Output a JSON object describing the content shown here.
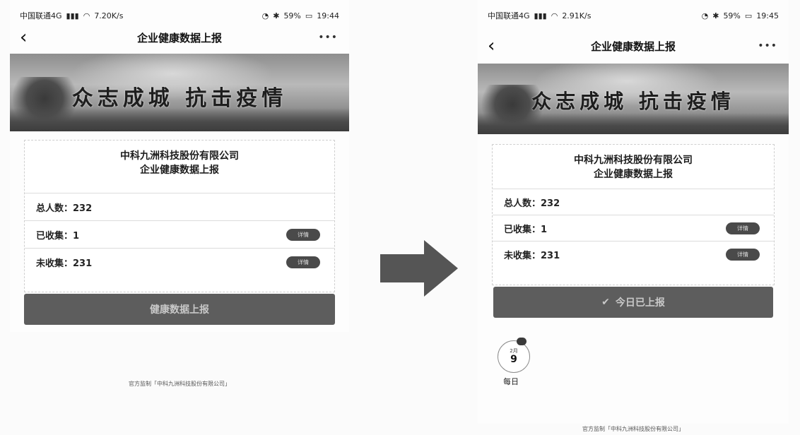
{
  "left": {
    "status": {
      "carrier": "中国联通4G",
      "speed": "7.20K/s",
      "battery": "59%",
      "time": "19:44"
    },
    "nav": {
      "back": "‹",
      "title": "企业健康数据上报",
      "more": "•••"
    },
    "banner": {
      "slogan": "众志成城 抗击疫情"
    },
    "card": {
      "company": "中科九洲科技股份有限公司",
      "subtitle": "企业健康数据上报",
      "rows": [
        {
          "label": "总人数：232",
          "pill": ""
        },
        {
          "label": "已收集：1",
          "pill": "详情"
        },
        {
          "label": "未收集：231",
          "pill": "详情"
        }
      ]
    },
    "button": {
      "label": "健康数据上报"
    },
    "footer": "官方监制「中科九洲科技股份有限公司」"
  },
  "right": {
    "status": {
      "carrier": "中国联通4G",
      "speed": "2.91K/s",
      "battery": "59%",
      "time": "19:45"
    },
    "nav": {
      "back": "‹",
      "title": "企业健康数据上报",
      "more": "•••"
    },
    "banner": {
      "slogan": "众志成城 抗击疫情"
    },
    "card": {
      "company": "中科九洲科技股份有限公司",
      "subtitle": "企业健康数据上报",
      "rows": [
        {
          "label": "总人数：232",
          "pill": ""
        },
        {
          "label": "已收集：1",
          "pill": "详情"
        },
        {
          "label": "未收集：231",
          "pill": "详情"
        }
      ]
    },
    "button": {
      "icon": "✔",
      "label": "今日已上报"
    },
    "calendar": {
      "month": "2月",
      "day": "9",
      "label": "每日"
    },
    "footer": "官方监制「中科九洲科技股份有限公司」"
  },
  "arrow": {
    "color": "#555555"
  }
}
